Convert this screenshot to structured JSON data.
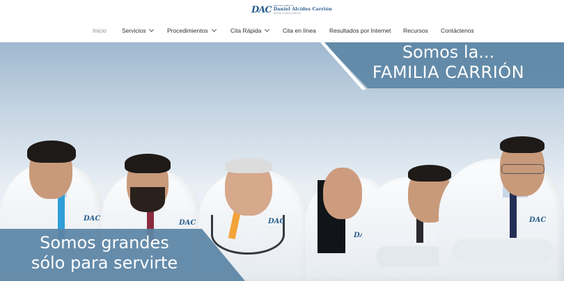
{
  "header": {
    "logo": {
      "mark": "DAC",
      "small_text": "CENTRO MÉDICO",
      "name": "Daniel Alcides Carrión",
      "tagline": "MAS DE 30 AÑOS CONTIGO"
    }
  },
  "nav": {
    "items": [
      {
        "label": "Inicio",
        "active": true
      },
      {
        "label": "Servicios",
        "dropdown": true
      },
      {
        "label": "Procedimientos",
        "dropdown": true
      },
      {
        "label": "Cita Rápida",
        "dropdown": true
      },
      {
        "label": "Cita en línea"
      },
      {
        "label": "Resultados por Internet"
      },
      {
        "label": "Recursos"
      },
      {
        "label": "Contáctenos"
      }
    ]
  },
  "hero": {
    "top_banner": {
      "line1": "Somos la...",
      "line2": "FAMILIA CARRIÓN"
    },
    "bottom_banner": {
      "line1": "Somos grandes",
      "line2": "sólo para servirte"
    },
    "embroidery": "DAC"
  },
  "colors": {
    "brand_blue": "#2b5f8f",
    "banner_blue": "#5e86a6",
    "nav_text": "#2e2e2e",
    "nav_active": "#8a8f96"
  }
}
